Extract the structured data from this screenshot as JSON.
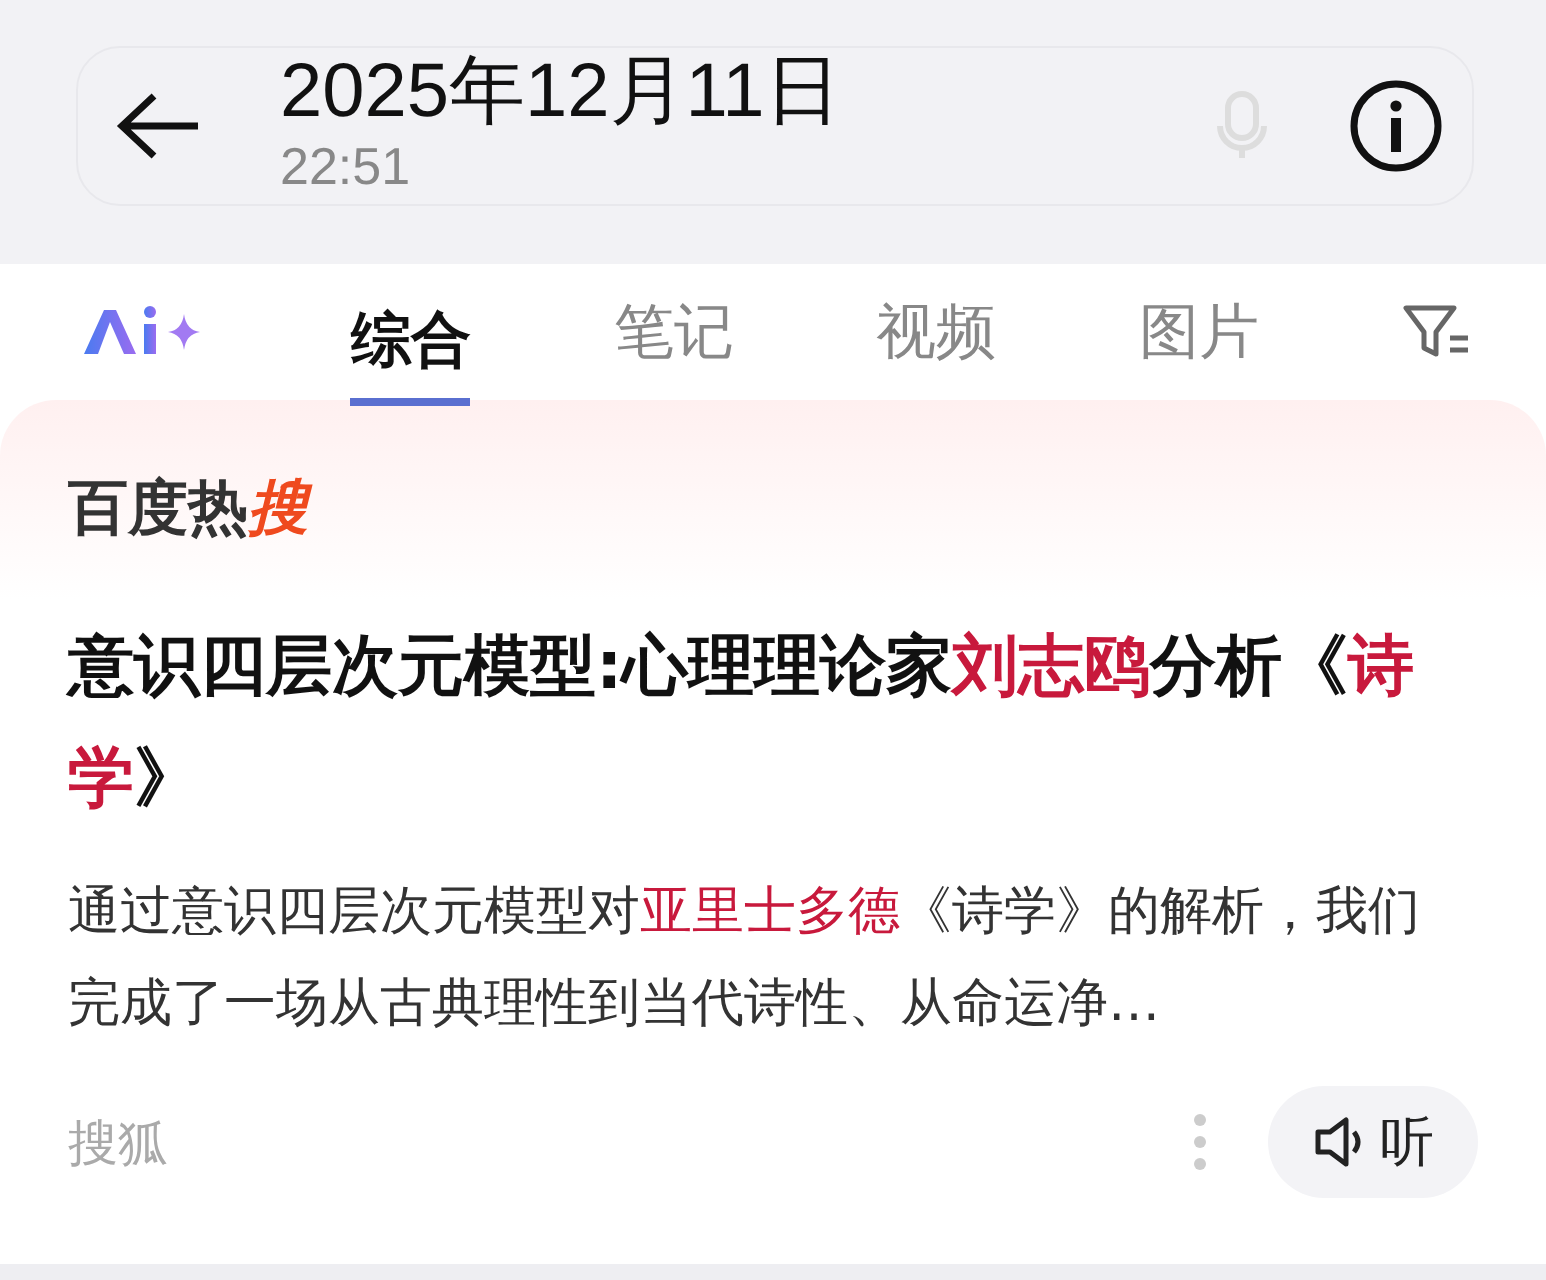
{
  "overlay": {
    "date": "2025年12月11日",
    "time": "22:51"
  },
  "tabs": [
    {
      "label": "综合",
      "selected": true
    },
    {
      "label": "笔记",
      "selected": false
    },
    {
      "label": "视频",
      "selected": false
    },
    {
      "label": "图片",
      "selected": false
    }
  ],
  "card": {
    "brand": [
      {
        "text": "百度热",
        "highlight": false
      },
      {
        "text": "搜",
        "highlight": true
      }
    ],
    "title": [
      {
        "text": "意识四层次元模型:心理理论家",
        "highlight": false
      },
      {
        "text": "刘志鸥",
        "highlight": true
      },
      {
        "text": "分析《",
        "highlight": false
      },
      {
        "text": "诗学",
        "highlight": true
      },
      {
        "text": "》",
        "highlight": false
      }
    ],
    "summary": [
      {
        "text": "通过意识四层次元模型对",
        "highlight": false
      },
      {
        "text": "亚里士多德",
        "highlight": true
      },
      {
        "text": "《诗学》的解析，我们完成了一场从古典理性到当代诗性、从命运净…",
        "highlight": false
      }
    ],
    "source": "搜狐",
    "listen": "听"
  }
}
